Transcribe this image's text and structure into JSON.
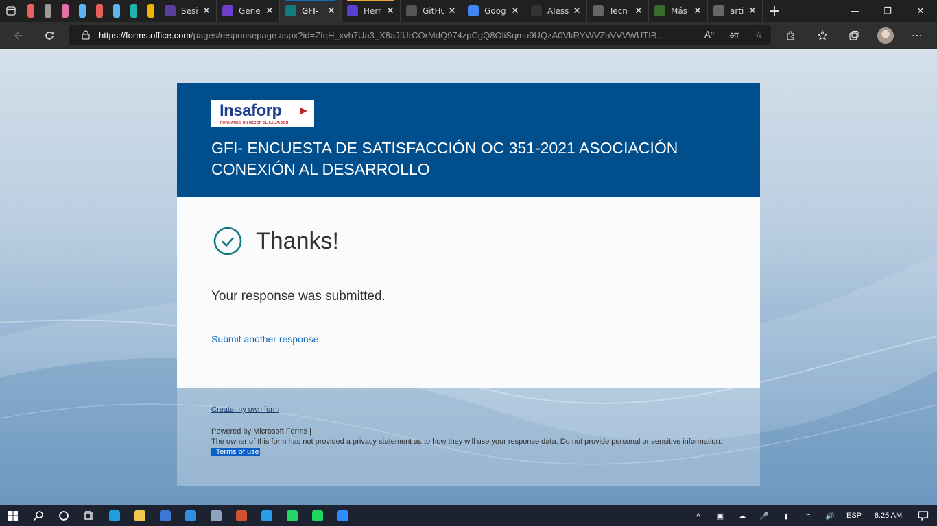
{
  "browser": {
    "tabs": [
      {
        "title": "Sesió",
        "fav_color": "#5b3fa0",
        "accent": "",
        "active": false
      },
      {
        "title": "Gene",
        "fav_color": "#6b3fc9",
        "accent": "",
        "active": false
      },
      {
        "title": "GFI-",
        "fav_color": "#107c80",
        "accent": "#0f6cbd",
        "active": true
      },
      {
        "title": "Herra",
        "fav_color": "#5c3ed0",
        "accent": "#e8a93a",
        "active": false
      },
      {
        "title": "GitHu",
        "fav_color": "#555",
        "accent": "",
        "active": false
      },
      {
        "title": "Goog",
        "fav_color": "#4285f4",
        "accent": "",
        "active": false
      },
      {
        "title": "Aless",
        "fav_color": "#333",
        "accent": "",
        "active": false
      },
      {
        "title": "Tecn",
        "fav_color": "#666",
        "accent": "",
        "active": false
      },
      {
        "title": "Más",
        "fav_color": "#3a6b2a",
        "accent": "",
        "active": false
      },
      {
        "title": "artifi",
        "fav_color": "#666",
        "accent": "",
        "active": false
      }
    ],
    "pinned_colors": [
      "#e8605e",
      "#9a9a9a",
      "#e46fa8",
      "#5ab6f0",
      "#e8605e",
      "#5ab6f0",
      "#1fb5a8",
      "#f0b400"
    ],
    "url_host": "https://forms.office.com",
    "url_path": "/pages/responsepage.aspx?id=ZIqH_xvh7Ua3_X8aJfUrCOrMdQ974zpCgQ8OliSqmu9UQzA0VkRYWVZaVVVWUTIB..."
  },
  "form": {
    "logo": {
      "brand": "Insaforp",
      "tagline": "FORMANDO UN MEJOR EL SALVADOR"
    },
    "title": "GFI- ENCUESTA DE SATISFACCIÓN OC 351-2021  ASOCIACIÓN CONEXIÓN AL DESARROLLO",
    "thanks": "Thanks!",
    "submitted_message": "Your response was submitted.",
    "submit_another": "Submit another response"
  },
  "footer": {
    "create_own": "Create my own form",
    "powered_by": "Powered by Microsoft Forms |",
    "privacy": "The owner of this form has not provided a privacy statement as to how they will use your response data. Do not provide personal or sensitive information.",
    "terms": "| Terms of use"
  },
  "taskbar": {
    "apps": [
      {
        "name": "edge-icon",
        "color": "#1f9fe0"
      },
      {
        "name": "file-explorer-icon",
        "color": "#f2c94c"
      },
      {
        "name": "store-icon",
        "color": "#3a78d8"
      },
      {
        "name": "mail-icon",
        "color": "#2f8fe0"
      },
      {
        "name": "photos-icon",
        "color": "#8ea4c0"
      },
      {
        "name": "powerpoint-icon",
        "color": "#d35230"
      },
      {
        "name": "vscode-icon",
        "color": "#2a9de8"
      },
      {
        "name": "whatsapp-icon",
        "color": "#25d366"
      },
      {
        "name": "spotify-icon",
        "color": "#1ed760"
      },
      {
        "name": "zoom-icon",
        "color": "#2d8cff"
      }
    ],
    "lang": "ESP",
    "time": "8:25 AM"
  }
}
